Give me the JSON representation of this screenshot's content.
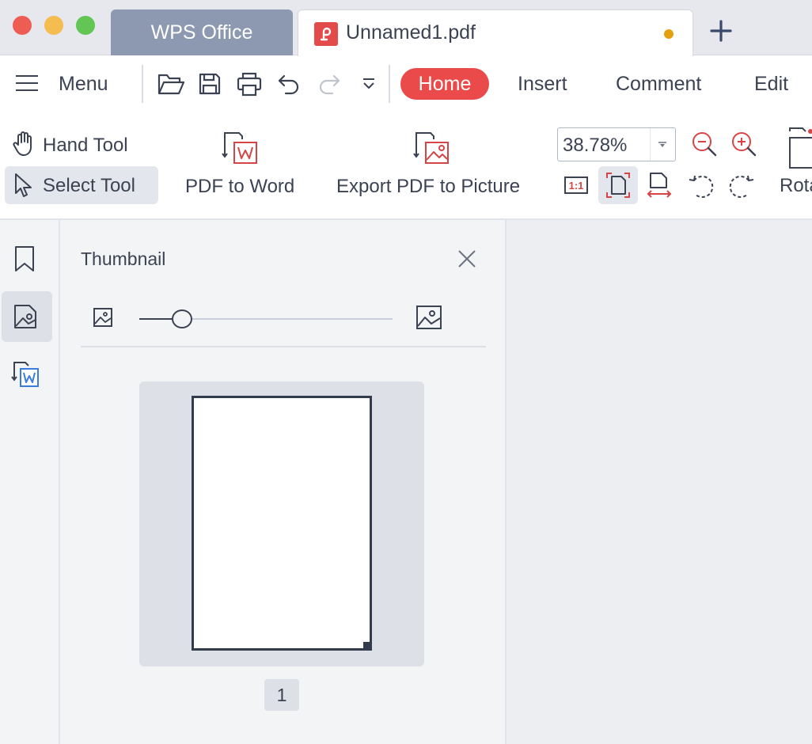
{
  "window": {
    "tabs": [
      {
        "label": "WPS Office"
      },
      {
        "label": "Unnamed1.pdf",
        "unsaved": true
      }
    ],
    "new_tab_icon": "plus-icon"
  },
  "menu_bar": {
    "menu_label": "Menu",
    "quick_icons": [
      "open-folder-icon",
      "save-icon",
      "print-icon",
      "undo-icon",
      "redo-icon",
      "more-dropdown-icon"
    ],
    "tabs": [
      "Home",
      "Insert",
      "Comment",
      "Edit"
    ],
    "active_tab": "Home"
  },
  "toolbar": {
    "hand_tool": "Hand Tool",
    "select_tool": "Select Tool",
    "pdf_to_word": "PDF to Word",
    "export_pdf_to_picture": "Export PDF to Picture",
    "zoom": "38.78%",
    "view_icons": [
      "actual-size-icon",
      "fit-page-icon",
      "fit-width-icon",
      "rotate-left-icon",
      "rotate-right-icon"
    ],
    "rotate_label_partial": "Rota"
  },
  "left_rail": {
    "items": [
      "bookmark-icon",
      "thumbnail-icon",
      "pdf-to-word-icon"
    ],
    "active": "thumbnail-icon"
  },
  "thumbnail_panel": {
    "title": "Thumbnail",
    "slider_value": 0.17,
    "pages": [
      {
        "number": "1"
      }
    ]
  },
  "colors": {
    "accent": "#ea4a4a",
    "tab_inactive": "#8d99b0",
    "unsaved_dot": "#e5a00d",
    "text": "#3b4252",
    "panel_bg": "#f3f4f6"
  }
}
